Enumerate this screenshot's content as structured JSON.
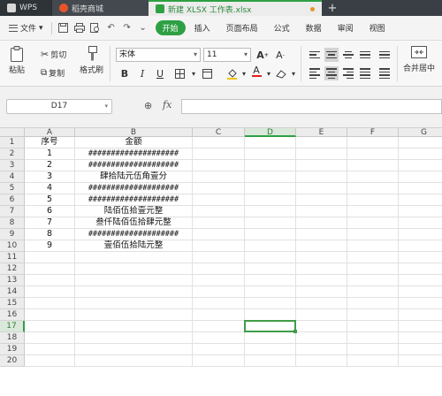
{
  "tabs": [
    {
      "label": "WPS"
    },
    {
      "label": "稻壳商城"
    },
    {
      "label": "新建 XLSX 工作表.xlsx"
    }
  ],
  "menubar": {
    "file_label": "文件",
    "start_label": "开始",
    "items": [
      "插入",
      "页面布局",
      "公式",
      "数据",
      "审阅",
      "视图"
    ]
  },
  "ribbon": {
    "paste_label": "粘贴",
    "cut_label": "剪切",
    "copy_label": "复制",
    "format_painter_label": "格式刷",
    "font_name": "宋体",
    "font_size": "11",
    "merge_label": "合并居中"
  },
  "formula_bar": {
    "cell_ref": "D17",
    "fx_label": "fx",
    "value": ""
  },
  "sheet": {
    "columns": [
      "A",
      "B",
      "C",
      "D",
      "E",
      "F",
      "G"
    ],
    "rows": [
      "1",
      "2",
      "3",
      "4",
      "5",
      "6",
      "7",
      "8",
      "9",
      "10",
      "11",
      "12",
      "13",
      "14",
      "15",
      "16",
      "17",
      "18",
      "19",
      "20"
    ],
    "active_cell": {
      "col": "D",
      "row": "17"
    },
    "data": [
      {
        "a": "序号",
        "b": "金额"
      },
      {
        "a": "1",
        "b": "####################"
      },
      {
        "a": "2",
        "b": "####################"
      },
      {
        "a": "3",
        "b": "肆拾陆元伍角壹分"
      },
      {
        "a": "4",
        "b": "####################"
      },
      {
        "a": "5",
        "b": "####################"
      },
      {
        "a": "6",
        "b": "陆佰伍拾壹元整"
      },
      {
        "a": "7",
        "b": "叁仟陆佰伍拾肆元整"
      },
      {
        "a": "8",
        "b": "####################"
      },
      {
        "a": "9",
        "b": "壹佰伍拾陆元整"
      }
    ]
  },
  "colors": {
    "accent": "#2ea043",
    "tabbar_bg": "#3a3f45"
  }
}
